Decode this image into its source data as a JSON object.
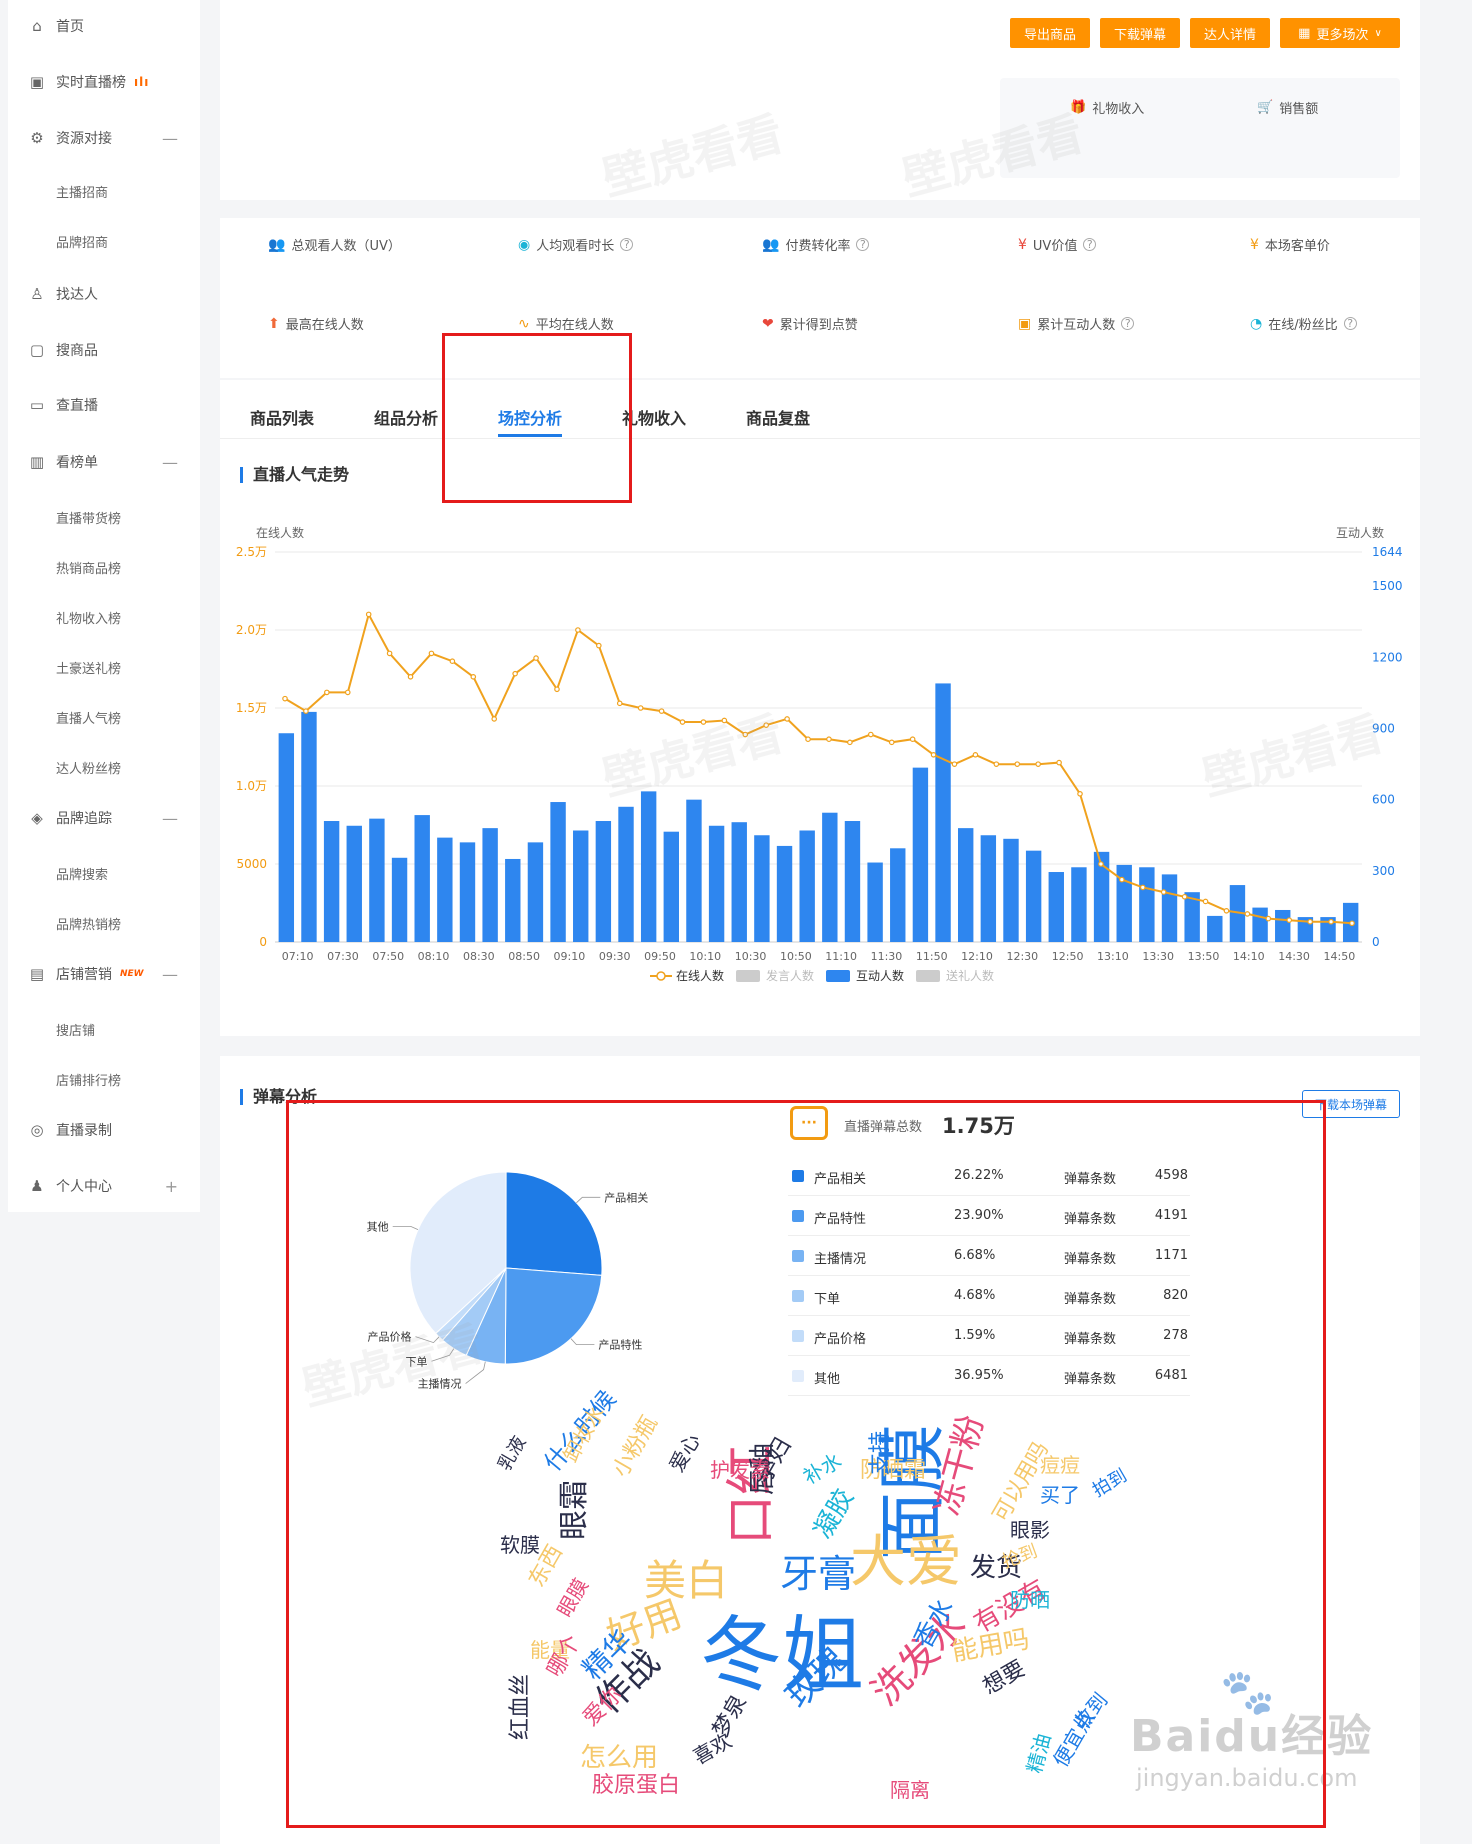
{
  "sidebar": {
    "items": [
      {
        "label": "首页",
        "icon": "home-icon",
        "glyph": "⌂",
        "expand": ""
      },
      {
        "label": "实时直播榜",
        "icon": "live-rank-icon",
        "glyph": "▣",
        "expand": ""
      },
      {
        "label": "资源对接",
        "icon": "resource-icon",
        "glyph": "⚙",
        "expand": "—"
      },
      {
        "label": "找达人",
        "icon": "find-talent-icon",
        "glyph": "♙",
        "expand": ""
      },
      {
        "label": "搜商品",
        "icon": "search-goods-icon",
        "glyph": "▢",
        "expand": ""
      },
      {
        "label": "查直播",
        "icon": "check-live-icon",
        "glyph": "▭",
        "expand": ""
      },
      {
        "label": "看榜单",
        "icon": "ranking-icon",
        "glyph": "▥",
        "expand": "—"
      },
      {
        "label": "品牌追踪",
        "icon": "brand-track-icon",
        "glyph": "◈",
        "expand": "—"
      },
      {
        "label": "店铺营销",
        "icon": "shop-marketing-icon",
        "glyph": "▤",
        "expand": "—"
      },
      {
        "label": "直播录制",
        "icon": "record-icon",
        "glyph": "◎",
        "expand": ""
      },
      {
        "label": "个人中心",
        "icon": "user-icon",
        "glyph": "♟",
        "expand": "+"
      }
    ],
    "sub_resource": [
      "主播招商",
      "品牌招商"
    ],
    "sub_ranking": [
      "直播带货榜",
      "热销商品榜",
      "礼物收入榜",
      "土豪送礼榜",
      "直播人气榜",
      "达人粉丝榜"
    ],
    "sub_brand": [
      "品牌搜索",
      "品牌热销榜"
    ],
    "sub_shop": [
      "搜店铺",
      "店铺排行榜"
    ],
    "new_badge": "NEW"
  },
  "header": {
    "buttons": [
      "导出商品",
      "下载弹幕",
      "达人详情",
      "更多场次"
    ],
    "gift_income": "礼物收入",
    "sales": "销售额"
  },
  "metrics": [
    {
      "label": "总观看人数（UV）",
      "help": false,
      "icon": "viewers-icon",
      "glyph": "👥",
      "color": "#1e7be6"
    },
    {
      "label": "人均观看时长",
      "help": true,
      "icon": "watch-time-icon",
      "glyph": "◉",
      "color": "#1bb4d6"
    },
    {
      "label": "付费转化率",
      "help": true,
      "icon": "conversion-icon",
      "glyph": "👥",
      "color": "#1e7be6"
    },
    {
      "label": "UV价值",
      "help": true,
      "icon": "uv-value-icon",
      "glyph": "¥",
      "color": "#e8473b"
    },
    {
      "label": "本场客单价",
      "help": false,
      "icon": "unit-price-icon",
      "glyph": "¥",
      "color": "#f29b12"
    },
    {
      "label": "最高在线人数",
      "help": false,
      "icon": "peak-online-icon",
      "glyph": "⬆",
      "color": "#f06a3a"
    },
    {
      "label": "平均在线人数",
      "help": false,
      "icon": "avg-online-icon",
      "glyph": "∿",
      "color": "#f29b12"
    },
    {
      "label": "累计得到点赞",
      "help": false,
      "icon": "likes-icon",
      "glyph": "❤",
      "color": "#e8473b"
    },
    {
      "label": "累计互动人数",
      "help": true,
      "icon": "interact-icon",
      "glyph": "▣",
      "color": "#f29b12"
    },
    {
      "label": "在线/粉丝比",
      "help": true,
      "icon": "ratio-icon",
      "glyph": "◔",
      "color": "#1bb4d6"
    }
  ],
  "tabs": [
    "商品列表",
    "组品分析",
    "场控分析",
    "礼物收入",
    "商品复盘"
  ],
  "active_tab": 2,
  "popularity": {
    "title": "直播人气走势",
    "left_axis_title": "在线人数",
    "right_axis_title": "互动人数"
  },
  "chart_data": {
    "type": "bar",
    "title": "直播人气走势",
    "x_tick_labels": [
      "07:10",
      "07:30",
      "07:50",
      "08:10",
      "08:30",
      "08:50",
      "09:10",
      "09:30",
      "09:50",
      "10:10",
      "10:30",
      "10:50",
      "11:10",
      "11:30",
      "11:50",
      "12:10",
      "12:30",
      "12:50",
      "13:10",
      "13:30",
      "13:50",
      "14:10",
      "14:30",
      "14:50"
    ],
    "y_left_ticks": [
      "0",
      "5000",
      "1.0万",
      "1.5万",
      "2.0万",
      "2.5万"
    ],
    "y_left_range": [
      0,
      25000
    ],
    "y_right_ticks": [
      "0",
      "300",
      "600",
      "900",
      "1200",
      "1500",
      "1644"
    ],
    "y_right_range": [
      0,
      1644
    ],
    "legend": [
      "在线人数",
      "发言人数",
      "互动人数",
      "送礼人数"
    ],
    "legend_colors": [
      "#f0a21e",
      "#cccccc",
      "#2e86ef",
      "#cccccc"
    ],
    "online_series": [
      15600,
      14800,
      16000,
      16000,
      21000,
      18500,
      17000,
      18500,
      18000,
      17000,
      14300,
      17200,
      18200,
      16200,
      20000,
      19000,
      15300,
      15000,
      14800,
      14100,
      14100,
      14200,
      13300,
      13900,
      14300,
      13000,
      13000,
      12800,
      13300,
      12800,
      13000,
      12000,
      11400,
      12000,
      11400,
      11400,
      11400,
      11500,
      9500,
      5000,
      4000,
      3500,
      3200,
      2900,
      2600,
      2000,
      1800,
      1500,
      1400,
      1300,
      1300,
      1200
    ],
    "interaction_series": [
      880,
      970,
      510,
      490,
      520,
      355,
      535,
      440,
      420,
      480,
      350,
      420,
      590,
      470,
      510,
      570,
      635,
      465,
      600,
      490,
      505,
      450,
      405,
      470,
      545,
      510,
      335,
      395,
      735,
      1090,
      480,
      450,
      435,
      385,
      295,
      315,
      380,
      325,
      315,
      285,
      210,
      110,
      240,
      145,
      135,
      105,
      105,
      165
    ]
  },
  "danmu": {
    "title": "弹幕分析",
    "download_label": "下载本场弹幕",
    "total_label": "直播弹幕总数",
    "total_value": "1.75万",
    "count_label": "弹幕条数",
    "categories": [
      {
        "name": "产品相关",
        "pct": "26.22%",
        "count": "4598",
        "share": 26.22,
        "color": "#1e7be6"
      },
      {
        "name": "产品特性",
        "pct": "23.90%",
        "count": "4191",
        "share": 23.9,
        "color": "#4c9af0"
      },
      {
        "name": "主播情况",
        "pct": "6.68%",
        "count": "1171",
        "share": 6.68,
        "color": "#78b3f3"
      },
      {
        "name": "下单",
        "pct": "4.68%",
        "count": "820",
        "share": 4.68,
        "color": "#a3cbf6"
      },
      {
        "name": "产品价格",
        "pct": "1.59%",
        "count": "278",
        "share": 1.59,
        "color": "#c2dcf9"
      },
      {
        "name": "其他",
        "pct": "36.95%",
        "count": "6481",
        "share": 36.95,
        "color": "#e1ecfb"
      }
    ]
  },
  "wordcloud": [
    {
      "t": "冬姐",
      "c": "#1e7be6"
    },
    {
      "t": "面膜",
      "c": "#1e7be6"
    },
    {
      "t": "大爱",
      "c": "#f5c86a"
    },
    {
      "t": "口红",
      "c": "#e64b7a"
    },
    {
      "t": "牙膏",
      "c": "#1e7be6"
    },
    {
      "t": "美白",
      "c": "#f5c86a"
    },
    {
      "t": "好用",
      "c": "#f5c86a"
    },
    {
      "t": "作战",
      "c": "#2b2e4a"
    },
    {
      "t": "眼霜",
      "c": "#2b2e4a"
    },
    {
      "t": "洗发水",
      "c": "#e64b7a"
    },
    {
      "t": "冻干粉",
      "c": "#e64b7a"
    },
    {
      "t": "有没有",
      "c": "#e64b7a"
    },
    {
      "t": "发货",
      "c": "#2b2e4a"
    },
    {
      "t": "能用吗",
      "c": "#f5c86a"
    },
    {
      "t": "玫瑰",
      "c": "#1e7be6"
    },
    {
      "t": "凝胶",
      "c": "#1bb4d6"
    },
    {
      "t": "唇釉",
      "c": "#2b2e4a"
    },
    {
      "t": "孕妇",
      "c": "#2b2e4a"
    },
    {
      "t": "精华",
      "c": "#1e7be6"
    },
    {
      "t": "怎么用",
      "c": "#f5c86a"
    },
    {
      "t": "胶原蛋白",
      "c": "#e64b7a"
    },
    {
      "t": "红血丝",
      "c": "#2b2e4a"
    },
    {
      "t": "软膜",
      "c": "#2b2e4a"
    },
    {
      "t": "乳液",
      "c": "#2b2e4a"
    },
    {
      "t": "防晒霜",
      "c": "#f5c86a"
    },
    {
      "t": "痘痘",
      "c": "#f5c86a"
    },
    {
      "t": "买了",
      "c": "#1e7be6"
    },
    {
      "t": "拍到",
      "c": "#1e7be6"
    },
    {
      "t": "眼影",
      "c": "#2b2e4a"
    },
    {
      "t": "抢到",
      "c": "#f5c86a"
    },
    {
      "t": "防晒",
      "c": "#1bb4d6"
    },
    {
      "t": "什么时候",
      "c": "#1e7be6"
    },
    {
      "t": "卸妆水",
      "c": "#f5c86a"
    },
    {
      "t": "小粉瓶",
      "c": "#f5c86a"
    },
    {
      "t": "护发素",
      "c": "#e64b7a"
    },
    {
      "t": "爱心",
      "c": "#2b2e4a"
    },
    {
      "t": "补水",
      "c": "#1bb4d6"
    },
    {
      "t": "支持",
      "c": "#1e7be6"
    },
    {
      "t": "香水",
      "c": "#1e7be6"
    },
    {
      "t": "想要",
      "c": "#2b2e4a"
    },
    {
      "t": "可以用吗",
      "c": "#f5c86a"
    },
    {
      "t": "隔离",
      "c": "#e64b7a"
    },
    {
      "t": "便宜点",
      "c": "#1e7be6"
    },
    {
      "t": "收到",
      "c": "#1e7be6"
    },
    {
      "t": "精油",
      "c": "#1bb4d6"
    },
    {
      "t": "梦泉",
      "c": "#2b2e4a"
    },
    {
      "t": "喜欢",
      "c": "#2b2e4a"
    },
    {
      "t": "能量",
      "c": "#f5c86a"
    },
    {
      "t": "哪个",
      "c": "#e64b7a"
    },
    {
      "t": "东西",
      "c": "#f5c86a"
    },
    {
      "t": "眼膜",
      "c": "#e64b7a"
    },
    {
      "t": "爱你",
      "c": "#e64b7a"
    }
  ],
  "footer_watermark": {
    "brand": "Baidu经验",
    "url": "jingyan.baidu.com"
  }
}
